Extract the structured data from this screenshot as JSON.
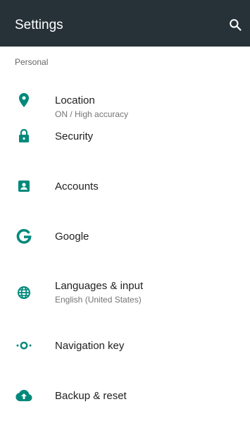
{
  "toolbar": {
    "title": "Settings",
    "search_icon": "search-icon",
    "background": "#263238"
  },
  "accent_color": "#00897B",
  "section": {
    "header": "Personal"
  },
  "items": [
    {
      "title": "Location",
      "summary": "ON / High accuracy",
      "icon": "location-pin-icon"
    },
    {
      "title": "Security",
      "summary": "",
      "icon": "lock-icon"
    },
    {
      "title": "Accounts",
      "summary": "",
      "icon": "account-box-icon"
    },
    {
      "title": "Google",
      "summary": "",
      "icon": "google-g-icon"
    },
    {
      "title": "Languages & input",
      "summary": "English (United States)",
      "icon": "globe-icon"
    },
    {
      "title": "Navigation key",
      "summary": "",
      "icon": "navigation-key-icon"
    },
    {
      "title": "Backup & reset",
      "summary": "",
      "icon": "cloud-upload-icon"
    }
  ]
}
